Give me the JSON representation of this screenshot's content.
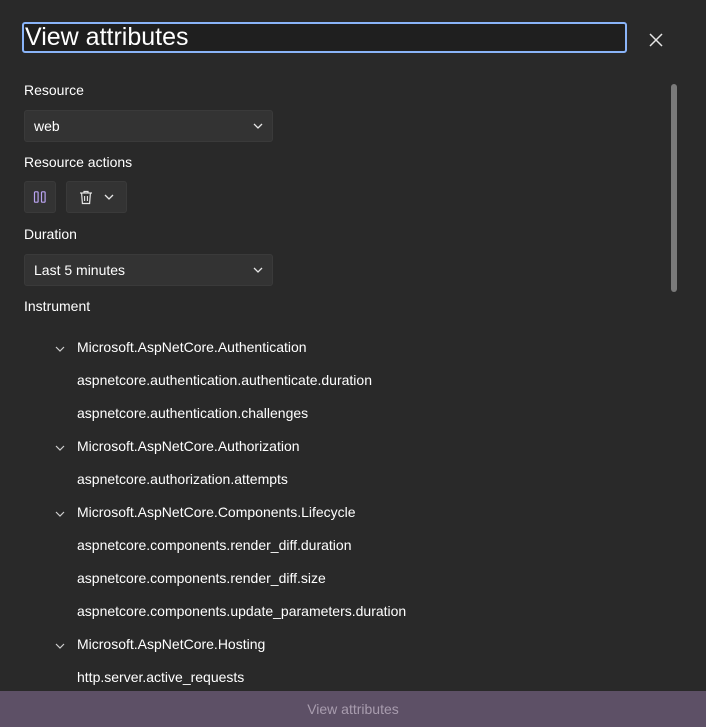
{
  "dialog": {
    "title": "View attributes",
    "close_icon": "close-icon"
  },
  "resource": {
    "label": "Resource",
    "value": "web"
  },
  "resource_actions": {
    "label": "Resource actions",
    "pause_icon": "pause-icon",
    "delete_icon": "trash-icon",
    "menu_icon": "chevron-down-icon"
  },
  "duration": {
    "label": "Duration",
    "value": "Last 5 minutes"
  },
  "instrument": {
    "label": "Instrument",
    "tree": [
      {
        "type": "group",
        "label": "Microsoft.AspNetCore.Authentication"
      },
      {
        "type": "item",
        "label": "aspnetcore.authentication.authenticate.duration"
      },
      {
        "type": "item",
        "label": "aspnetcore.authentication.challenges"
      },
      {
        "type": "group",
        "label": "Microsoft.AspNetCore.Authorization"
      },
      {
        "type": "item",
        "label": "aspnetcore.authorization.attempts"
      },
      {
        "type": "group",
        "label": "Microsoft.AspNetCore.Components.Lifecycle"
      },
      {
        "type": "item",
        "label": "aspnetcore.components.render_diff.duration"
      },
      {
        "type": "item",
        "label": "aspnetcore.components.render_diff.size"
      },
      {
        "type": "item",
        "label": "aspnetcore.components.update_parameters.duration"
      },
      {
        "type": "group",
        "label": "Microsoft.AspNetCore.Hosting"
      },
      {
        "type": "item",
        "label": "http.server.active_requests"
      }
    ]
  },
  "footer": {
    "button_label": "View attributes"
  },
  "colors": {
    "background": "#292929",
    "focus_border": "#8ab4f8",
    "accent_icon": "#b9a3f0",
    "footer_button": "#5d5066"
  }
}
